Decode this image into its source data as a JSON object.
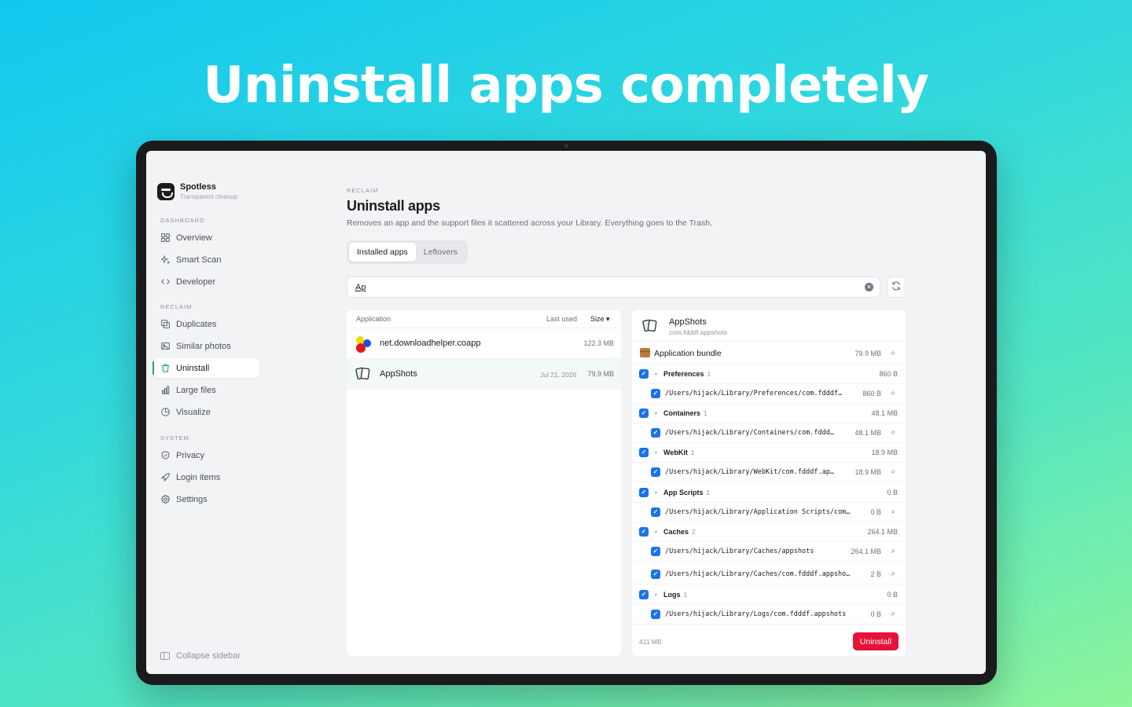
{
  "headline": "Uninstall apps completely",
  "brand": {
    "name": "Spotless",
    "tagline": "Transparent cleanup",
    "icon": "spotless-logo-icon"
  },
  "sidebar": {
    "sections": [
      {
        "label": "DASHBOARD",
        "items": [
          {
            "label": "Overview",
            "icon": "grid-icon"
          },
          {
            "label": "Smart Scan",
            "icon": "sparkle-icon"
          },
          {
            "label": "Developer",
            "icon": "code-icon"
          }
        ]
      },
      {
        "label": "RECLAIM",
        "items": [
          {
            "label": "Duplicates",
            "icon": "copy-icon"
          },
          {
            "label": "Similar photos",
            "icon": "photo-icon"
          },
          {
            "label": "Uninstall",
            "icon": "trash-icon",
            "active": true
          },
          {
            "label": "Large files",
            "icon": "bar-chart-icon"
          },
          {
            "label": "Visualize",
            "icon": "pie-icon"
          }
        ]
      },
      {
        "label": "SYSTEM",
        "items": [
          {
            "label": "Privacy",
            "icon": "shield-icon"
          },
          {
            "label": "Login items",
            "icon": "rocket-icon"
          },
          {
            "label": "Settings",
            "icon": "gear-icon"
          }
        ]
      }
    ],
    "collapse_label": "Collapse sidebar"
  },
  "main": {
    "crumb": "RECLAIM",
    "title": "Uninstall apps",
    "subtitle": "Removes an app and the support files it scattered across your Library. Everything goes to the Trash.",
    "tabs": [
      {
        "label": "Installed apps",
        "active": true
      },
      {
        "label": "Leftovers",
        "active": false
      }
    ],
    "search": {
      "value": "Ap",
      "placeholder": ""
    }
  },
  "app_list": {
    "columns": {
      "application": "Application",
      "last_used": "Last used",
      "size": "Size ▾"
    },
    "rows": [
      {
        "name": "net.downloadhelper.coapp",
        "last_used": "",
        "size": "122.3 MB",
        "icon": "coapp-icon",
        "selected": false
      },
      {
        "name": "AppShots",
        "last_used": "Jul 21, 2026",
        "size": "79.9 MB",
        "icon": "appshots-icon",
        "selected": true
      }
    ]
  },
  "detail": {
    "name": "AppShots",
    "bundle_id": "com.fdddf.appshots",
    "bundle": {
      "label": "Application bundle",
      "size": "79.9 MB"
    },
    "groups": [
      {
        "label": "Preferences",
        "count": "1",
        "size": "860 B",
        "files": [
          {
            "path": "/Users/hijack/Library/Preferences/com.fdddf…",
            "size": "860 B"
          }
        ]
      },
      {
        "label": "Containers",
        "count": "1",
        "size": "48.1 MB",
        "files": [
          {
            "path": "/Users/hijack/Library/Containers/com.fddd…",
            "size": "48.1 MB"
          }
        ]
      },
      {
        "label": "WebKit",
        "count": "1",
        "size": "18.9 MB",
        "files": [
          {
            "path": "/Users/hijack/Library/WebKit/com.fdddf.ap…",
            "size": "18.9 MB"
          }
        ]
      },
      {
        "label": "App Scripts",
        "count": "1",
        "size": "0 B",
        "files": [
          {
            "path": "/Users/hijack/Library/Application Scripts/com…",
            "size": "0 B"
          }
        ]
      },
      {
        "label": "Caches",
        "count": "2",
        "size": "264.1 MB",
        "files": [
          {
            "path": "/Users/hijack/Library/Caches/appshots",
            "size": "264.1 MB"
          },
          {
            "path": "/Users/hijack/Library/Caches/com.fdddf.appsho…",
            "size": "2 B"
          }
        ]
      },
      {
        "label": "Logs",
        "count": "1",
        "size": "0 B",
        "files": [
          {
            "path": "/Users/hijack/Library/Logs/com.fdddf.appshots",
            "size": "0 B"
          }
        ]
      }
    ],
    "total": "411 MB",
    "uninstall_label": "Uninstall"
  },
  "colors": {
    "accent": "#1fa67a",
    "checkbox": "#1a73e8",
    "danger": "#e5133a"
  }
}
